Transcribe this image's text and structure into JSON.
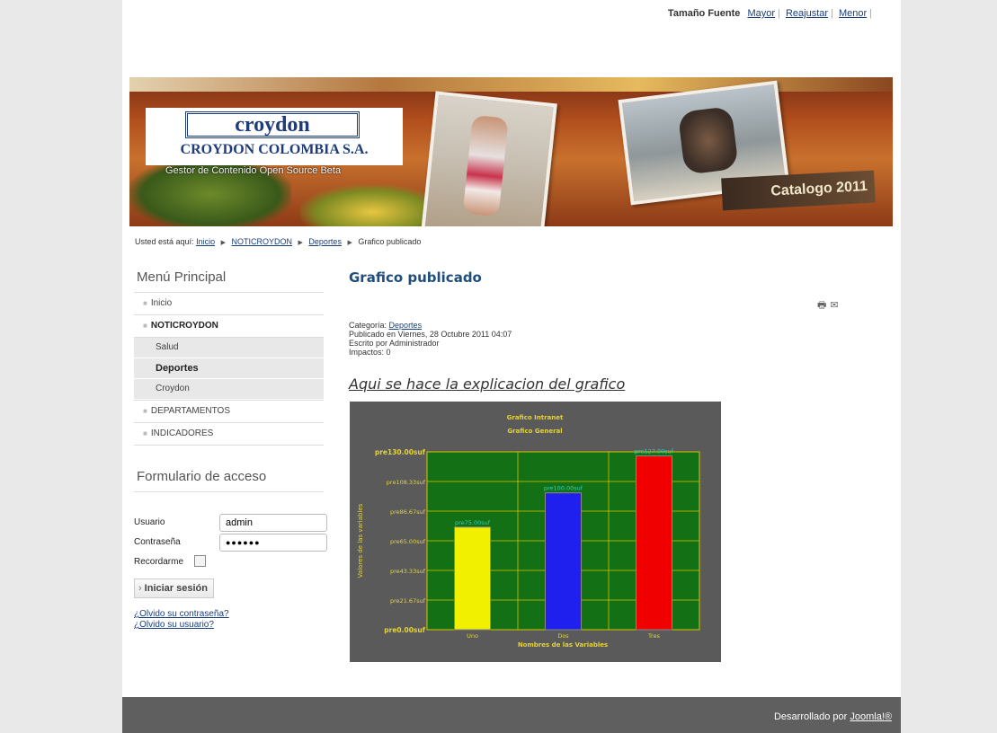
{
  "header": {
    "font_size_label": "Tamaño Fuente",
    "font_size_links": [
      "Mayor",
      "Reajustar",
      "Menor"
    ]
  },
  "banner": {
    "logo_word": "croydon",
    "logo_name": "CROYDON COLOMBIA S.A.",
    "tagline": "Gestor de Contenido Open Source Beta",
    "catalog_text": "Catalogo 2011"
  },
  "breadcrumb": {
    "prefix": "Usted está aquí:",
    "items": [
      "Inicio",
      "NOTICROYDON",
      "Deportes",
      "Grafico publicado"
    ]
  },
  "sidebar": {
    "menu_title": "Menú Principal",
    "menu": [
      {
        "label": "Inicio"
      },
      {
        "label": "NOTICROYDON"
      },
      {
        "label": "Salud"
      },
      {
        "label": "Deportes"
      },
      {
        "label": "Croydon"
      },
      {
        "label": "DEPARTAMENTOS"
      },
      {
        "label": "INDICADORES"
      }
    ],
    "login_title": "Formulario de acceso",
    "username_label": "Usuario",
    "username_value": "admin",
    "password_label": "Contraseña",
    "password_value": "●●●●●●",
    "remember_label": "Recordarme",
    "login_button": "Iniciar sesión",
    "forgot_password": "¿Olvido su contraseña?",
    "forgot_username": "¿Olvido su usuario?"
  },
  "article": {
    "title": "Grafico publicado",
    "category_label": "Categoría:",
    "category_value": "Deportes",
    "published": "Publicado en Viernes, 28 Octubre 2011 04:07",
    "author": "Escrito por Administrador",
    "hits": "Impactos: 0",
    "subhead": "Aqui se hace la explicacion del grafico"
  },
  "chart_data": {
    "type": "bar",
    "title": "Grafico Intranet",
    "subtitle": "Grafico General",
    "xlabel": "Nombres de las Variables",
    "ylabel": "Valores de las variables",
    "categories": [
      "Uno",
      "Dos",
      "Tres"
    ],
    "values": [
      75,
      100,
      127
    ],
    "value_labels": [
      "pre75.00suf",
      "pre100.00suf",
      "pre127.00suf"
    ],
    "bar_colors": [
      "#f0f000",
      "#2020ee",
      "#f00000"
    ],
    "ylim": [
      0,
      130
    ],
    "yticks": [
      "pre0.00suf",
      "pre21.67suf",
      "pre43.33suf",
      "pre65.00suf",
      "pre86.67suf",
      "pre108.33suf",
      "pre130.00suf"
    ],
    "grid": true,
    "plot_bg": "#147014",
    "frame_bg": "#5a5a5a",
    "grid_color": "#d8c200"
  },
  "footer": {
    "text": "Desarrollado por",
    "link": "Joomla!®"
  }
}
